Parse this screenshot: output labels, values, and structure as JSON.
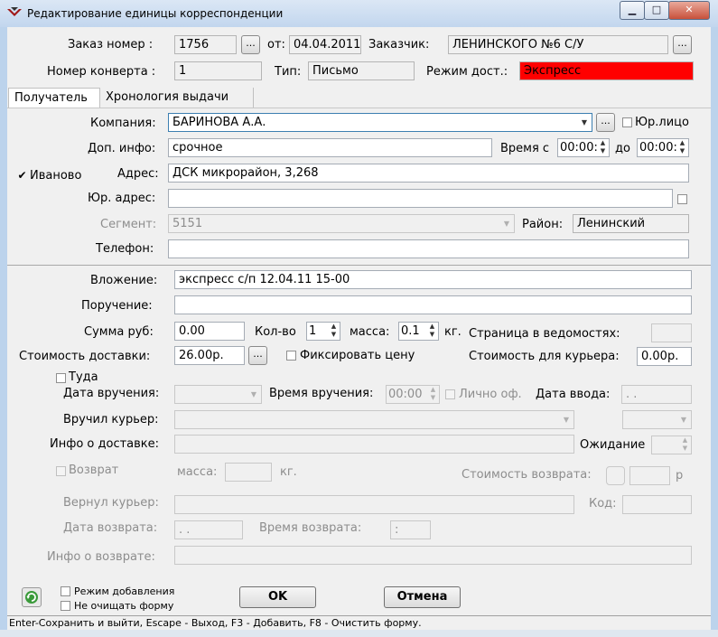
{
  "window": {
    "title": "Редактирование единицы корреспонденции",
    "controls": {
      "minimize": "▁",
      "maximize": "□",
      "close": "✕"
    }
  },
  "header": {
    "order_label": "Заказ номер :",
    "order_value": "1756",
    "from_label": "от:",
    "from_value": "04.04.2011",
    "customer_label": "Заказчик:",
    "customer_value": "ЛЕНИНСКОГО №6 С/У",
    "envelope_label": "Номер конверта :",
    "envelope_value": "1",
    "type_label": "Тип:",
    "type_value": "Письмо",
    "mode_label": "Режим дост.:",
    "mode_value": "Экспресс",
    "mode_color": "#ff0000",
    "ellipsis": "..."
  },
  "tabs": [
    {
      "label": "Получатель",
      "active": true
    },
    {
      "label": "Хронология выдачи",
      "active": false
    }
  ],
  "recipient": {
    "company_label": "Компания:",
    "company_value": "БАРИНОВА А.А.",
    "legal_entity_label": "Юр.лицо",
    "extra_label": "Доп. инфо:",
    "extra_value": "срочное",
    "time_from_label": "Время с",
    "time_from_value": "00:00:",
    "time_to_label": "до",
    "time_to_value": "00:00:",
    "city_label": "Иваново",
    "city_checked": true,
    "address_label": "Адрес:",
    "address_value": "ДСК микрорайон, 3,268",
    "legal_address_label": "Юр. адрес:",
    "legal_address_value": "",
    "segment_label": "Сегмент:",
    "segment_value": "5151",
    "district_label": "Район:",
    "district_value": "Ленинский",
    "phone_label": "Телефон:",
    "phone_value": ""
  },
  "details": {
    "attachment_label": "Вложение:",
    "attachment_value": "экспресс с/п 12.04.11 15-00",
    "assignment_label": "Поручение:",
    "assignment_value": "",
    "sum_label": "Сумма руб:",
    "sum_value": "0.00",
    "qty_label": "Кол-во",
    "qty_value": "1",
    "mass_label": "масса:",
    "mass_value": "0.1",
    "kg": "кг.",
    "page_label": "Страница в ведомостях:",
    "page_value": "",
    "cost_label": "Стоимость доставки:",
    "cost_value": "26.00р.",
    "fix_price_label": "Фиксировать цену",
    "courier_cost_label": "Стоимость для курьера:",
    "courier_cost_value": "0.00р.",
    "there_label": "Туда",
    "delivery_date_label": "Дата вручения:",
    "delivery_time_label": "Время вручения:",
    "delivery_time_value": "00:00",
    "personally_label": "Лично оф.",
    "input_date_label": "Дата ввода:",
    "input_date_value": " .  .",
    "courier_label": "Вручил курьер:",
    "delivery_info_label": "Инфо о доставке:",
    "waiting_label": "Ожидание",
    "return_label": "Возврат",
    "return_mass_label": "масса:",
    "return_kg": "кг.",
    "return_cost_label": "Стоимость возврата:",
    "return_currency": "р",
    "returned_courier_label": "Вернул курьер:",
    "code_label": "Код:",
    "return_date_label": "Дата возврата:",
    "return_date_value": " .  .",
    "return_time_label": "Время возврата:",
    "return_time_value": " :",
    "return_info_label": "Инфо о возврате:"
  },
  "footer": {
    "add_mode_label": "Режим добавления",
    "no_clear_label": "Не очищать форму",
    "ok_label": "OK",
    "cancel_label": "Отмена",
    "status_text": "Enter-Сохранить и выйти, Escape - Выход, F3 - Добавить, F8 - Очистить форму."
  }
}
